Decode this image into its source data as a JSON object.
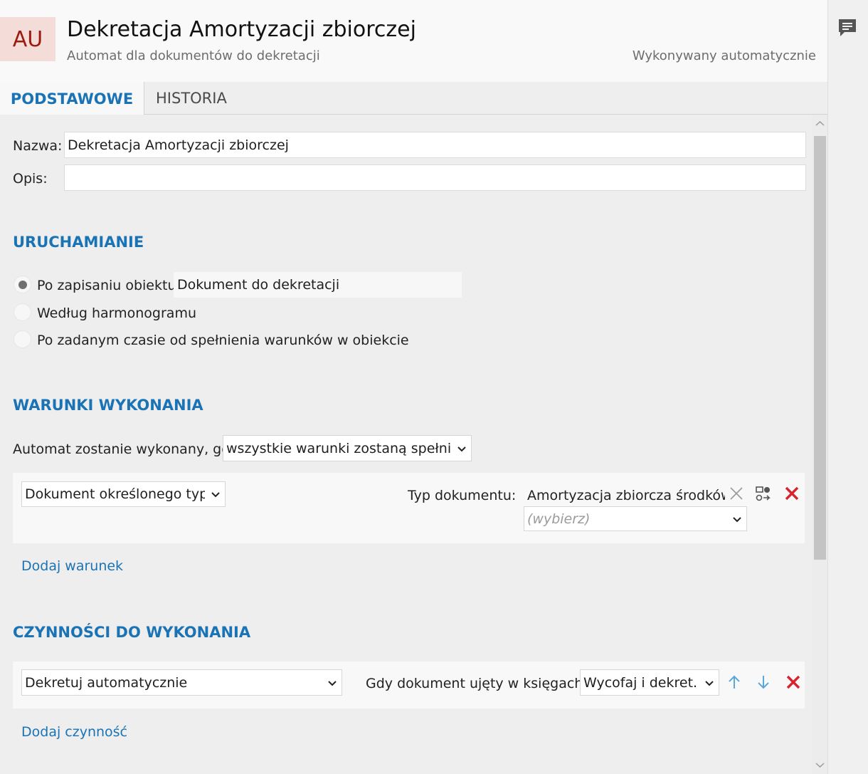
{
  "header": {
    "avatar_text": "AU",
    "title": "Dekretacja Amortyzacji zbiorczej",
    "subtitle": "Automat dla dokumentów do dekretacji",
    "mode": "Wykonywany automatycznie"
  },
  "side_panel": {
    "icon": "comment-icon"
  },
  "tabs": [
    {
      "label": "PODSTAWOWE",
      "active": true
    },
    {
      "label": "HISTORIA",
      "active": false
    }
  ],
  "form": {
    "name_label": "Nazwa:",
    "name_value": "Dekretacja Amortyzacji zbiorczej",
    "desc_label": "Opis:",
    "desc_value": ""
  },
  "triggering": {
    "title": "URUCHAMIANIE",
    "options": [
      {
        "label": "Po zapisaniu obiektu",
        "selected": true
      },
      {
        "label": "Według harmonogramu",
        "selected": false
      },
      {
        "label": "Po zadanym czasie od spełnienia warunków w obiekcie",
        "selected": false
      }
    ],
    "object_value": "Dokument do dekretacji"
  },
  "conditions": {
    "title": "WARUNKI WYKONANIA",
    "rule_label": "Automat zostanie wykonany, gdy",
    "rule_value": "wszystkie warunki zostaną spełnione",
    "items": [
      {
        "type": "Dokument określonego typu",
        "param_label": "Typ dokumentu:",
        "param_value": "Amortyzacja zbiorcza środków tr",
        "picker_placeholder": "(wybierz)"
      }
    ],
    "add_link": "Dodaj warunek"
  },
  "actions": {
    "title": "CZYNNOŚCI DO WYKONANIA",
    "items": [
      {
        "action": "Dekretuj automatycznie",
        "option_label": "Gdy dokument ujęty w księgach:",
        "option_value": "Wycofaj i dekret..."
      }
    ],
    "add_link": "Dodaj czynność"
  },
  "colors": {
    "accent": "#1a73b5",
    "delete": "#d9232c",
    "arrow": "#5aa7dc",
    "avatar_bg": "#f4dcd9",
    "avatar_fg": "#9c1b10"
  },
  "icons": [
    "comment-icon",
    "clear-x-icon",
    "settings-swap-icon",
    "delete-icon",
    "arrow-up-icon",
    "arrow-down-icon",
    "chevron-down-icon"
  ]
}
